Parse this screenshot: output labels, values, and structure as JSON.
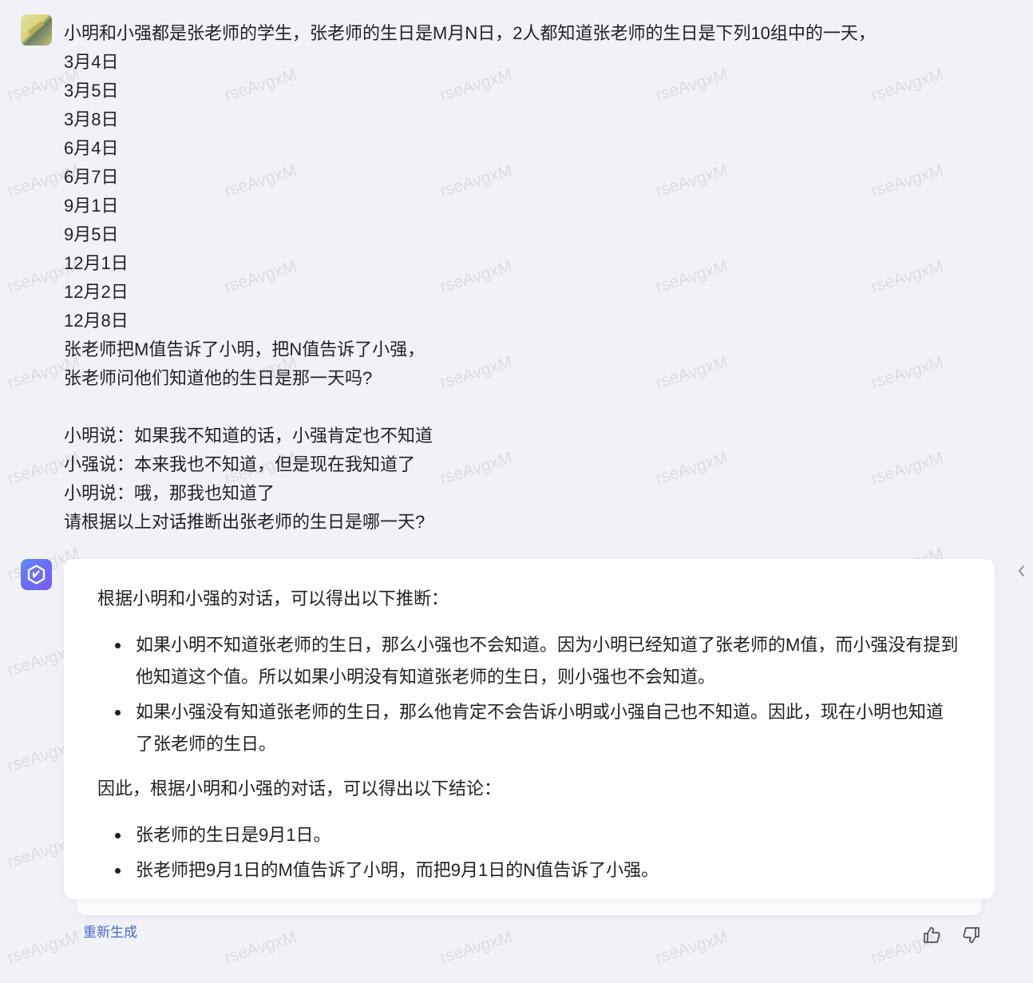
{
  "watermark": "rseAvgxM",
  "user_message": {
    "lines": [
      "小明和小强都是张老师的学生，张老师的生日是M月N日，2人都知道张老师的生日是下列10组中的一天，",
      "3月4日",
      "3月5日",
      "3月8日",
      "6月4日",
      "6月7日",
      "9月1日",
      "9月5日",
      "12月1日",
      "12月2日",
      "12月8日",
      "张老师把M值告诉了小明，把N值告诉了小强，",
      "张老师问他们知道他的生日是那一天吗?",
      "",
      "小明说：如果我不知道的话，小强肯定也不知道",
      "小强说：本来我也不知道，但是现在我知道了",
      "小明说：哦，那我也知道了",
      "请根据以上对话推断出张老师的生日是哪一天?"
    ]
  },
  "reply": {
    "intro": "根据小明和小强的对话，可以得出以下推断：",
    "bullets_1": [
      "如果小明不知道张老师的生日，那么小强也不会知道。因为小明已经知道了张老师的M值，而小强没有提到他知道这个值。所以如果小明没有知道张老师的生日，则小强也不会知道。",
      "如果小强没有知道张老师的生日，那么他肯定不会告诉小明或小强自己也不知道。因此，现在小明也知道了张老师的生日。"
    ],
    "conclusion_intro": "因此，根据小明和小强的对话，可以得出以下结论：",
    "bullets_2": [
      "张老师的生日是9月1日。",
      "张老师把9月1日的M值告诉了小明，而把9月1日的N值告诉了小强。"
    ]
  },
  "actions": {
    "regenerate_label": "重新生成",
    "thumbs_up_icon": "thumbs-up-icon",
    "thumbs_down_icon": "thumbs-down-icon"
  },
  "colors": {
    "background": "#f1f2f7",
    "card": "#ffffff",
    "link": "#4a66d8",
    "ai_avatar": "#6a6cf7"
  }
}
